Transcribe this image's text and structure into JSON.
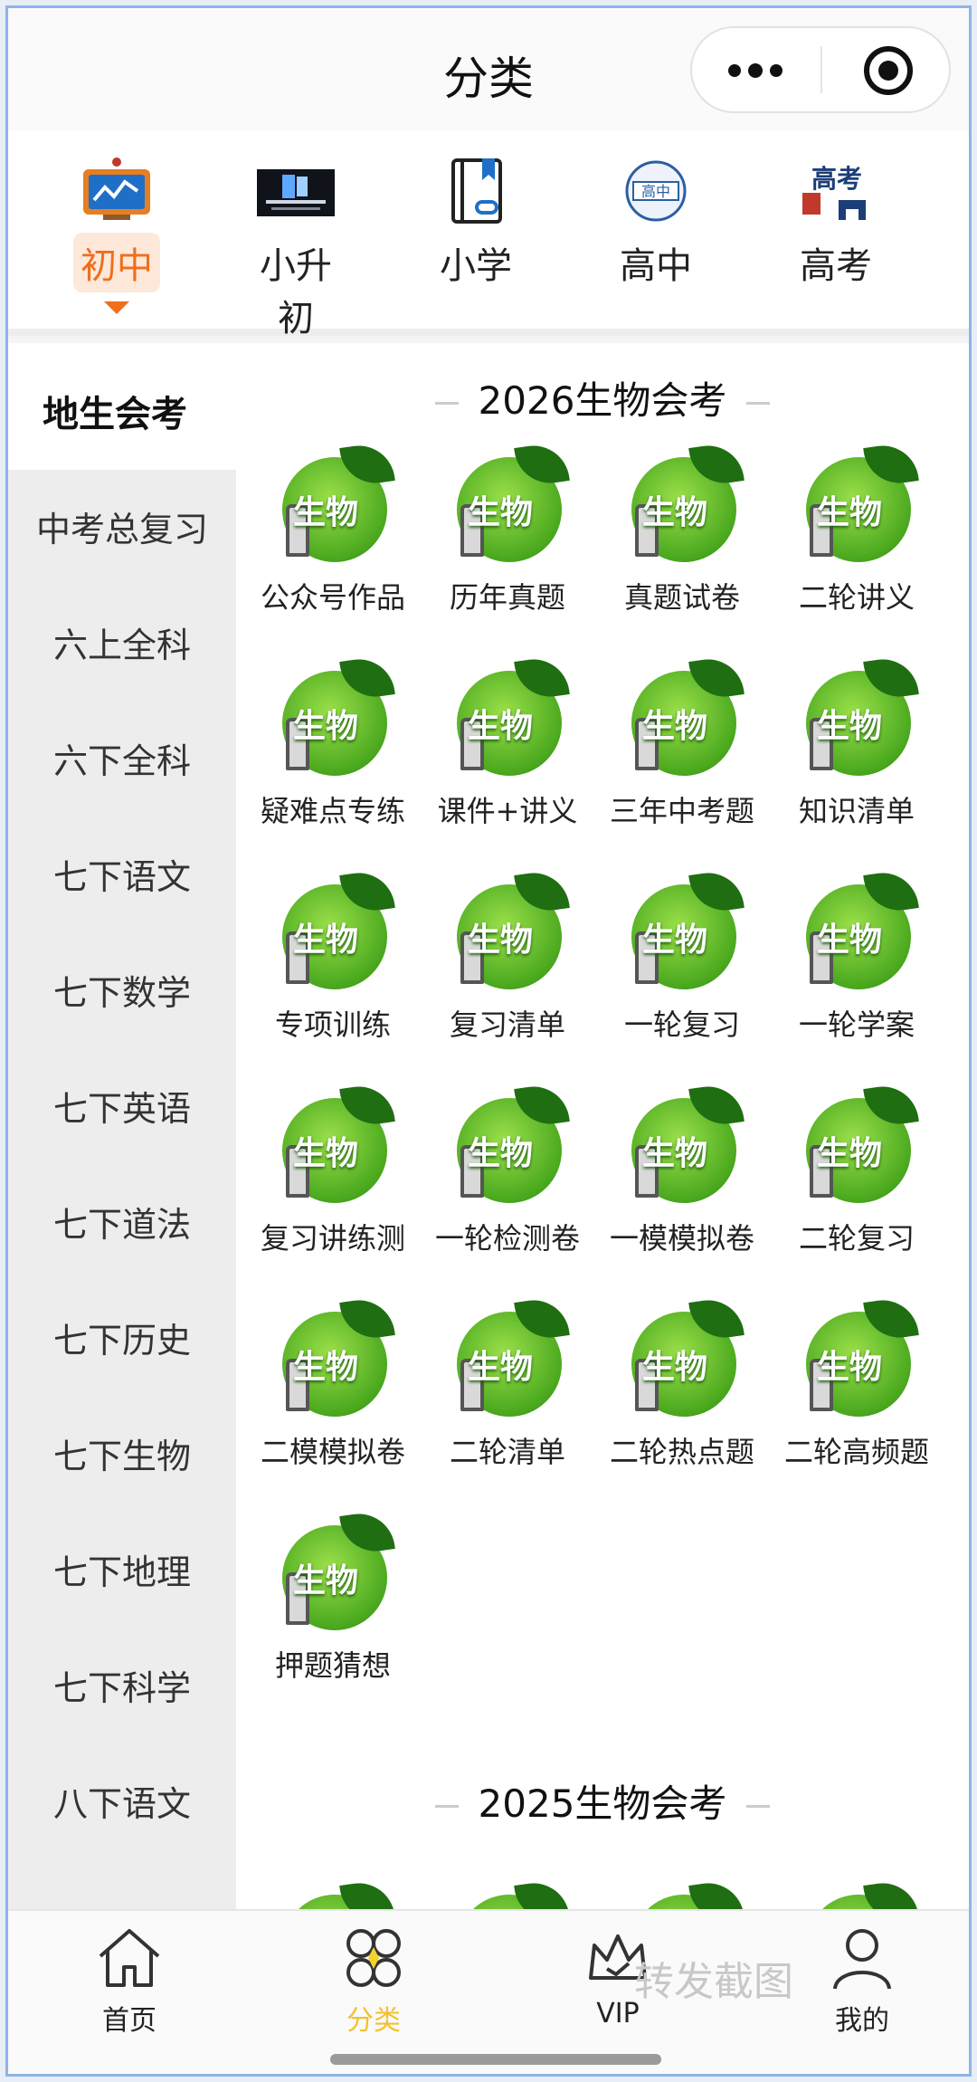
{
  "header": {
    "title": "分类"
  },
  "grades": [
    {
      "label": "初中",
      "active": true,
      "icon": "monitor-chart-icon"
    },
    {
      "label": "小升初",
      "active": false,
      "icon": "poster-thumbnail-icon"
    },
    {
      "label": "小学",
      "active": false,
      "icon": "book-bookmark-icon"
    },
    {
      "label": "高中",
      "active": false,
      "icon": "senior-high-badge-icon"
    },
    {
      "label": "高考",
      "active": false,
      "icon": "gaokao-gate-icon"
    }
  ],
  "sidebar": {
    "active": "地生会考",
    "items": [
      "中考总复习",
      "六上全科",
      "六下全科",
      "七下语文",
      "七下数学",
      "七下英语",
      "七下道法",
      "七下历史",
      "七下生物",
      "七下地理",
      "七下科学",
      "八下语文"
    ]
  },
  "sections": [
    {
      "title": "2026生物会考",
      "badge_text": "生物",
      "items": [
        "公众号作品",
        "历年真题",
        "真题试卷",
        "二轮讲义",
        "疑难点专练",
        "课件+讲义",
        "三年中考题",
        "知识清单",
        "专项训练",
        "复习清单",
        "一轮复习",
        "一轮学案",
        "复习讲练测",
        "一轮检测卷",
        "一模模拟卷",
        "二轮复习",
        "二模模拟卷",
        "二轮清单",
        "二轮热点题",
        "二轮高频题",
        "押题猜想"
      ]
    },
    {
      "title": "2025生物会考"
    }
  ],
  "tabbar": {
    "items": [
      {
        "label": "首页",
        "icon": "home-icon",
        "active": false
      },
      {
        "label": "分类",
        "icon": "category-clover-icon",
        "active": true
      },
      {
        "label": "VIP",
        "icon": "crown-icon",
        "active": false
      },
      {
        "label": "我的",
        "icon": "profile-icon",
        "active": false
      }
    ],
    "watermark": "转发截图"
  },
  "colors": {
    "accent_orange": "#ef6f1c",
    "active_tab_yellow": "#f2c12e",
    "badge_green": "#4aa81e"
  }
}
